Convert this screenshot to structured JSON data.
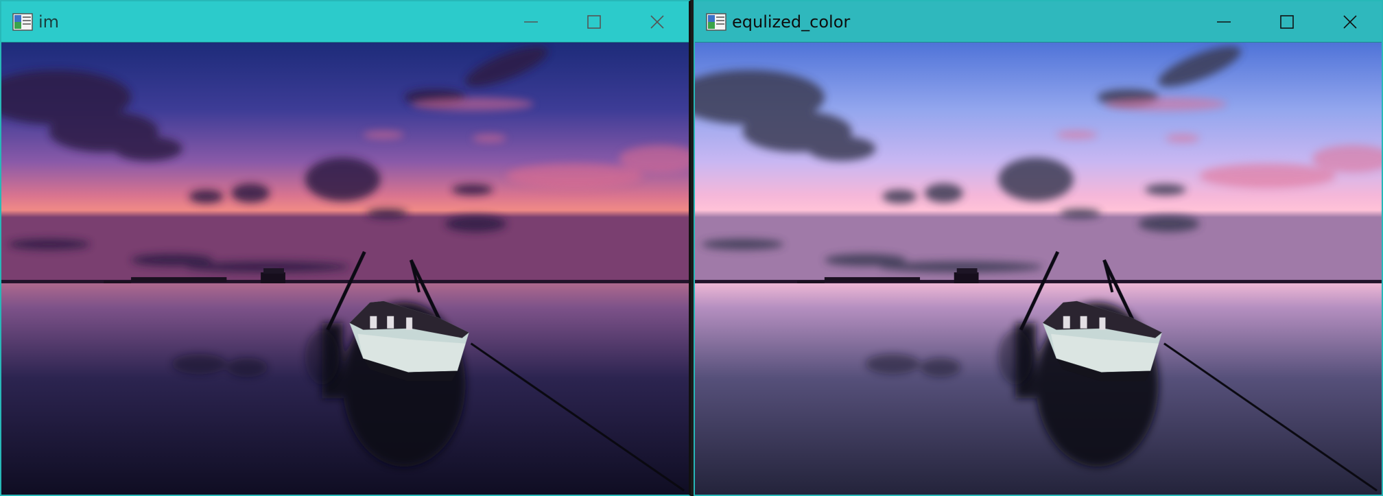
{
  "windows": [
    {
      "title": "im",
      "controls": {
        "minimize": "minimize-icon",
        "maximize": "maximize-icon",
        "close": "close-icon"
      },
      "image": "sunset-lake-boat-original"
    },
    {
      "title": "equlized_color",
      "controls": {
        "minimize": "minimize-icon",
        "maximize": "maximize-icon",
        "close": "close-icon"
      },
      "image": "sunset-lake-boat-equalized"
    }
  ],
  "colors": {
    "titlebar_active": "#2ccbcb",
    "titlebar_second": "#2fb8bd",
    "border": "#27b8b8"
  }
}
